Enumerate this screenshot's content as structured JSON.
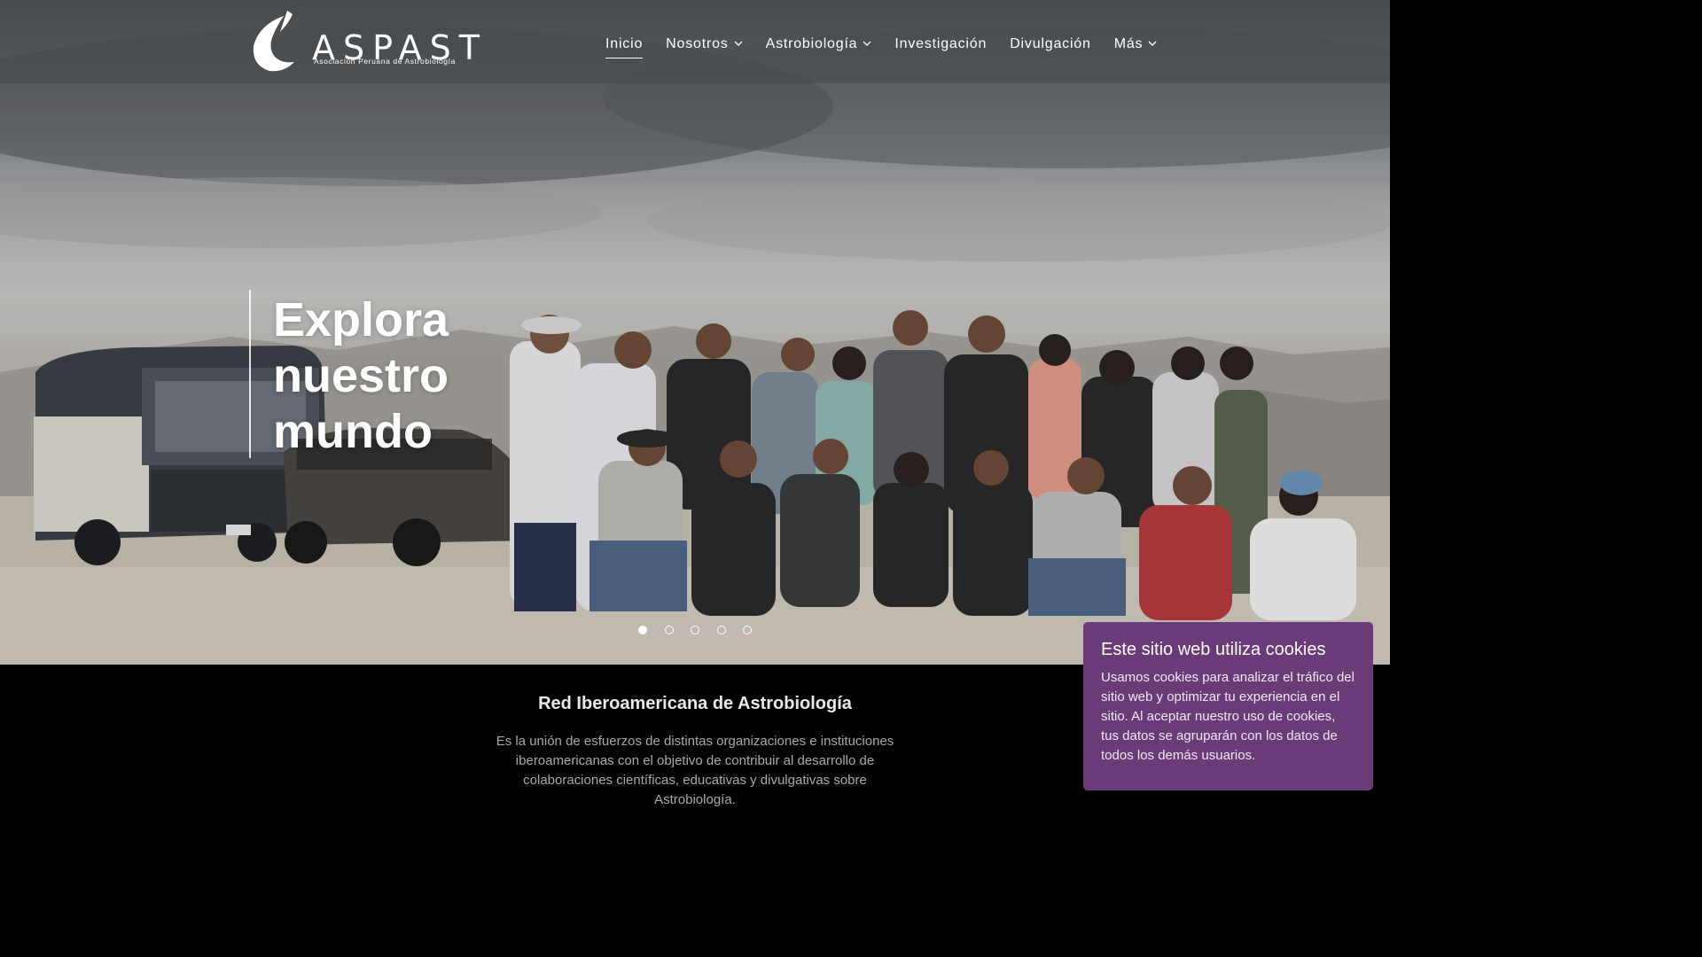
{
  "site": {
    "logo_text": "ASPAST",
    "logo_subtitle": "Asociación Peruana de Astrobiología"
  },
  "nav": {
    "items": [
      {
        "label": "Inicio",
        "active": true,
        "has_dropdown": false
      },
      {
        "label": "Nosotros",
        "active": false,
        "has_dropdown": true
      },
      {
        "label": "Astrobiología",
        "active": false,
        "has_dropdown": true
      },
      {
        "label": "Investigación",
        "active": false,
        "has_dropdown": false
      },
      {
        "label": "Divulgación",
        "active": false,
        "has_dropdown": false
      },
      {
        "label": "Más",
        "active": false,
        "has_dropdown": true
      }
    ]
  },
  "hero": {
    "title_line1": "Explora",
    "title_line2": "nuestro",
    "title_line3": "mundo",
    "slides_total": 5,
    "active_slide": 1
  },
  "section": {
    "title": "Red Iberoamericana de Astrobiología",
    "body": "Es la unión de esfuerzos de distintas organizaciones e instituciones iberoamericanas con el objetivo de contribuir al desarrollo de colaboraciones científicas, educativas y divulgativas sobre Astrobiología."
  },
  "cookie": {
    "title": "Este sitio web utiliza cookies",
    "text": "Usamos cookies para analizar el tráfico del sitio web y optimizar tu experiencia en el sitio. Al aceptar nuestro uso de cookies, tus datos se agruparán con los datos de todos los demás usuarios."
  },
  "colors": {
    "cookie_bg": "#6a3b78",
    "header_overlay": "rgba(70,72,75,0.55)",
    "section_bg": "#000000"
  }
}
